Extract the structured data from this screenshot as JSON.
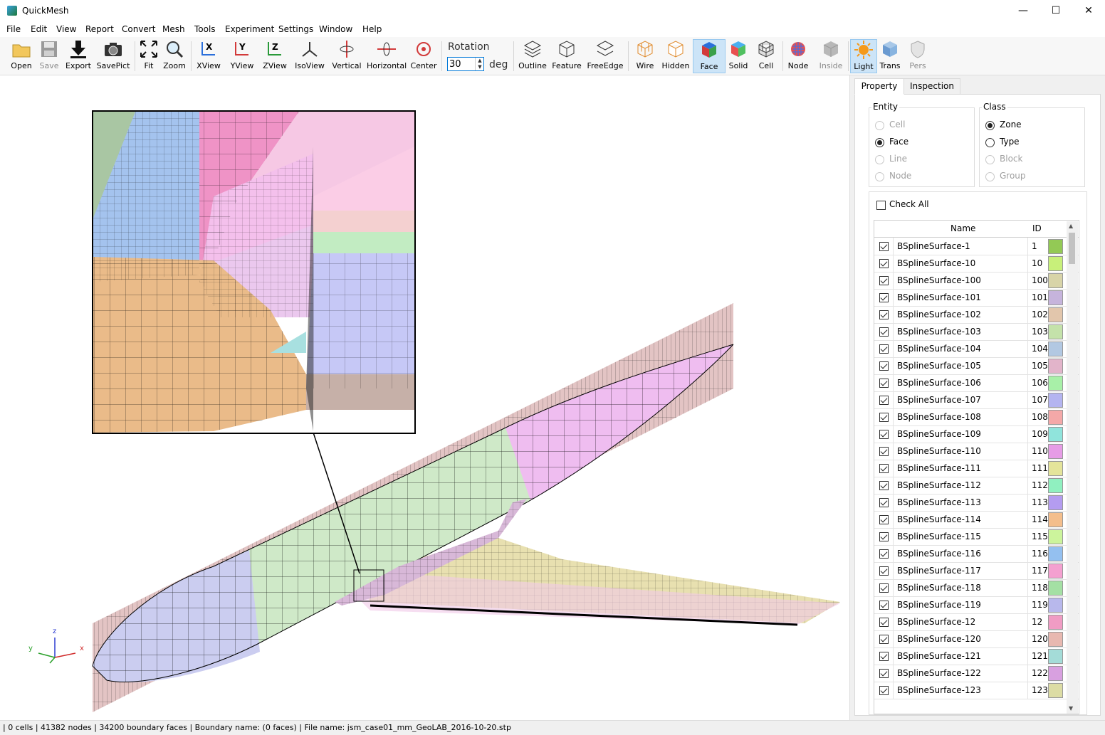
{
  "window": {
    "title": "QuickMesh",
    "minimize": "—",
    "maximize": "☐",
    "close": "✕"
  },
  "menu": [
    "File",
    "Edit",
    "View",
    "Report",
    "Convert",
    "Mesh",
    "Tools",
    "Experiment",
    "Settings",
    "Window",
    "Help"
  ],
  "toolbar": {
    "open": "Open",
    "save": "Save",
    "export": "Export",
    "savepict": "SavePict",
    "fit": "Fit",
    "zoom": "Zoom",
    "xview": "XView",
    "yview": "YView",
    "zview": "ZView",
    "isoview": "IsoView",
    "vertical": "Vertical",
    "horizontal": "Horizontal",
    "center": "Center",
    "rotation_label": "Rotation",
    "rotation_value": "30",
    "rotation_unit": "deg",
    "outline": "Outline",
    "feature": "Feature",
    "freeedge": "FreeEdge",
    "wire": "Wire",
    "hidden": "Hidden",
    "face": "Face",
    "solid": "Solid",
    "cell": "Cell",
    "node": "Node",
    "inside": "Inside",
    "light": "Light",
    "trans": "Trans",
    "pers": "Pers"
  },
  "axes": {
    "x": "x",
    "y": "y",
    "z": "z"
  },
  "panel": {
    "tabs": [
      "Property",
      "Inspection"
    ],
    "entity": {
      "title": "Entity",
      "options": [
        "Cell",
        "Face",
        "Line",
        "Node"
      ],
      "selected": "Face"
    },
    "class": {
      "title": "Class",
      "options": [
        "Zone",
        "Type",
        "Block",
        "Group"
      ],
      "selected": "Zone"
    },
    "check_all": "Check All",
    "columns": {
      "name": "Name",
      "id": "ID"
    },
    "rows": [
      {
        "name": "BSplineSurface-1",
        "id": "1",
        "color": "#93c955"
      },
      {
        "name": "BSplineSurface-10",
        "id": "10",
        "color": "#c8f07a"
      },
      {
        "name": "BSplineSurface-100",
        "id": "100",
        "color": "#d8d4a8"
      },
      {
        "name": "BSplineSurface-101",
        "id": "101",
        "color": "#c6b4dc"
      },
      {
        "name": "BSplineSurface-102",
        "id": "102",
        "color": "#e2c6ac"
      },
      {
        "name": "BSplineSurface-103",
        "id": "103",
        "color": "#c4e2aa"
      },
      {
        "name": "BSplineSurface-104",
        "id": "104",
        "color": "#b2c8e2"
      },
      {
        "name": "BSplineSurface-105",
        "id": "105",
        "color": "#e2b4ca"
      },
      {
        "name": "BSplineSurface-106",
        "id": "106",
        "color": "#a8f0a8"
      },
      {
        "name": "BSplineSurface-107",
        "id": "107",
        "color": "#b4b4f0"
      },
      {
        "name": "BSplineSurface-108",
        "id": "108",
        "color": "#f4a8a8"
      },
      {
        "name": "BSplineSurface-109",
        "id": "109",
        "color": "#90e4dc"
      },
      {
        "name": "BSplineSurface-110",
        "id": "110",
        "color": "#e69ce6"
      },
      {
        "name": "BSplineSurface-111",
        "id": "111",
        "color": "#e4e49a"
      },
      {
        "name": "BSplineSurface-112",
        "id": "112",
        "color": "#90f0c0"
      },
      {
        "name": "BSplineSurface-113",
        "id": "113",
        "color": "#b49cf0"
      },
      {
        "name": "BSplineSurface-114",
        "id": "114",
        "color": "#f4be8c"
      },
      {
        "name": "BSplineSurface-115",
        "id": "115",
        "color": "#ccf49c"
      },
      {
        "name": "BSplineSurface-116",
        "id": "116",
        "color": "#94c0f0"
      },
      {
        "name": "BSplineSurface-117",
        "id": "117",
        "color": "#f4a0d0"
      },
      {
        "name": "BSplineSurface-118",
        "id": "118",
        "color": "#a4e0a4"
      },
      {
        "name": "BSplineSurface-119",
        "id": "119",
        "color": "#b8b8ec"
      },
      {
        "name": "BSplineSurface-12",
        "id": "12",
        "color": "#f09cc4"
      },
      {
        "name": "BSplineSurface-120",
        "id": "120",
        "color": "#e8b8b0"
      },
      {
        "name": "BSplineSurface-121",
        "id": "121",
        "color": "#a4dcd8"
      },
      {
        "name": "BSplineSurface-122",
        "id": "122",
        "color": "#d8a0e0"
      },
      {
        "name": "BSplineSurface-123",
        "id": "123",
        "color": "#dcdca4"
      }
    ]
  },
  "status": "| 0 cells | 41382 nodes | 34200 boundary faces |  Boundary name:  (0 faces) | File name: jsm_case01_mm_GeoLAB_2016-10-20.stp"
}
